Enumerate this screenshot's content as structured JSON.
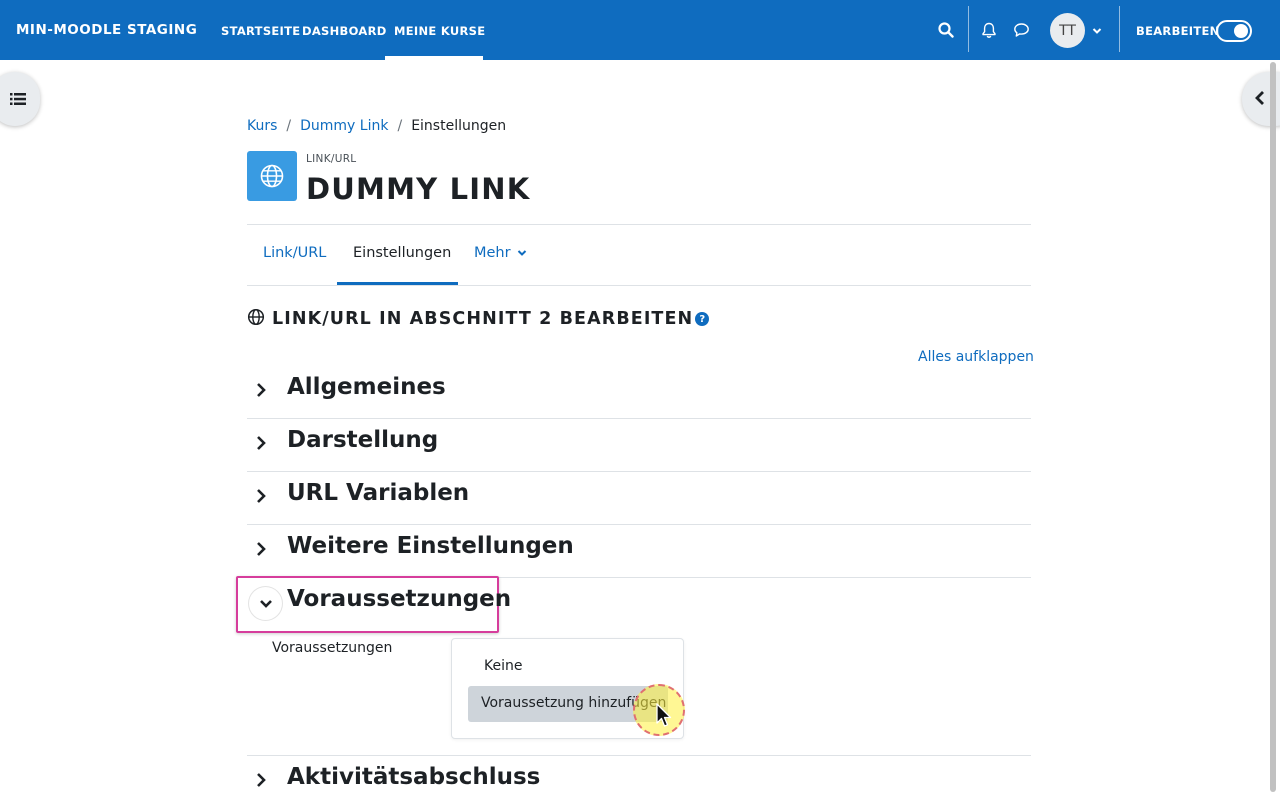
{
  "navbar": {
    "brand": "MIN-MOODLE STAGING",
    "items": [
      "STARTSEITE",
      "DASHBOARD",
      "MEINE KURSE"
    ],
    "active_item": "MEINE KURSE",
    "avatar_initials": "TT",
    "edit_mode_label": "BEARBEITEN",
    "accent_color": "#0f6cbf"
  },
  "breadcrumb": [
    "Kurs",
    "Dummy Link",
    "Einstellungen"
  ],
  "header": {
    "activity_type": "LINK/URL",
    "title": "DUMMY LINK",
    "icon": "globe-icon"
  },
  "secondary_nav": {
    "tabs": [
      "Link/URL",
      "Einstellungen",
      "Mehr"
    ],
    "active_tab": "Einstellungen"
  },
  "form": {
    "heading": "LINK/URL IN ABSCHNITT 2 BEARBEITEN",
    "help": "?",
    "expand_all": "Alles aufklappen",
    "sections": [
      "Allgemeines",
      "Darstellung",
      "URL Variablen",
      "Weitere Einstellungen",
      "Voraussetzungen",
      "Aktivitätsabschluss"
    ],
    "expanded_section": "Voraussetzungen",
    "restrictions": {
      "label": "Voraussetzungen",
      "options": [
        "Keine",
        "Voraussetzung hinzufügen"
      ],
      "hovered_option": "Voraussetzung hinzufügen"
    }
  }
}
